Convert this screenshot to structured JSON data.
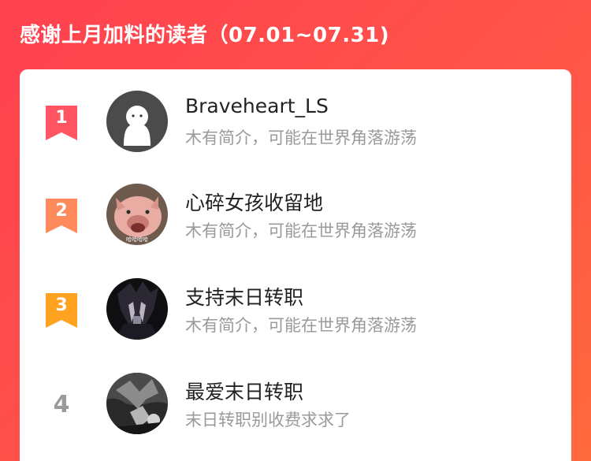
{
  "header": {
    "title": "感谢上月加料的读者（07.01~07.31)"
  },
  "colors": {
    "rank1": "#ff5563",
    "rank2": "#ff8a5c",
    "rank3": "#ffa21f",
    "rank_plain": "#9b9b9b"
  },
  "readers": [
    {
      "rank": "1",
      "name": "Braveheart_LS",
      "bio": "木有简介，可能在世界角落游荡",
      "avatar": "ghost-avatar"
    },
    {
      "rank": "2",
      "name": "心碎女孩收留地",
      "bio": "木有简介，可能在世界角落游荡",
      "avatar": "pig-avatar",
      "avatar_caption": "哈哈哈哈"
    },
    {
      "rank": "3",
      "name": "支持末日转职",
      "bio": "木有简介，可能在世界角落游荡",
      "avatar": "anime-avatar"
    },
    {
      "rank": "4",
      "name": "最爱末日转职",
      "bio": "末日转职别收费求求了",
      "avatar": "fantasy-avatar"
    }
  ]
}
